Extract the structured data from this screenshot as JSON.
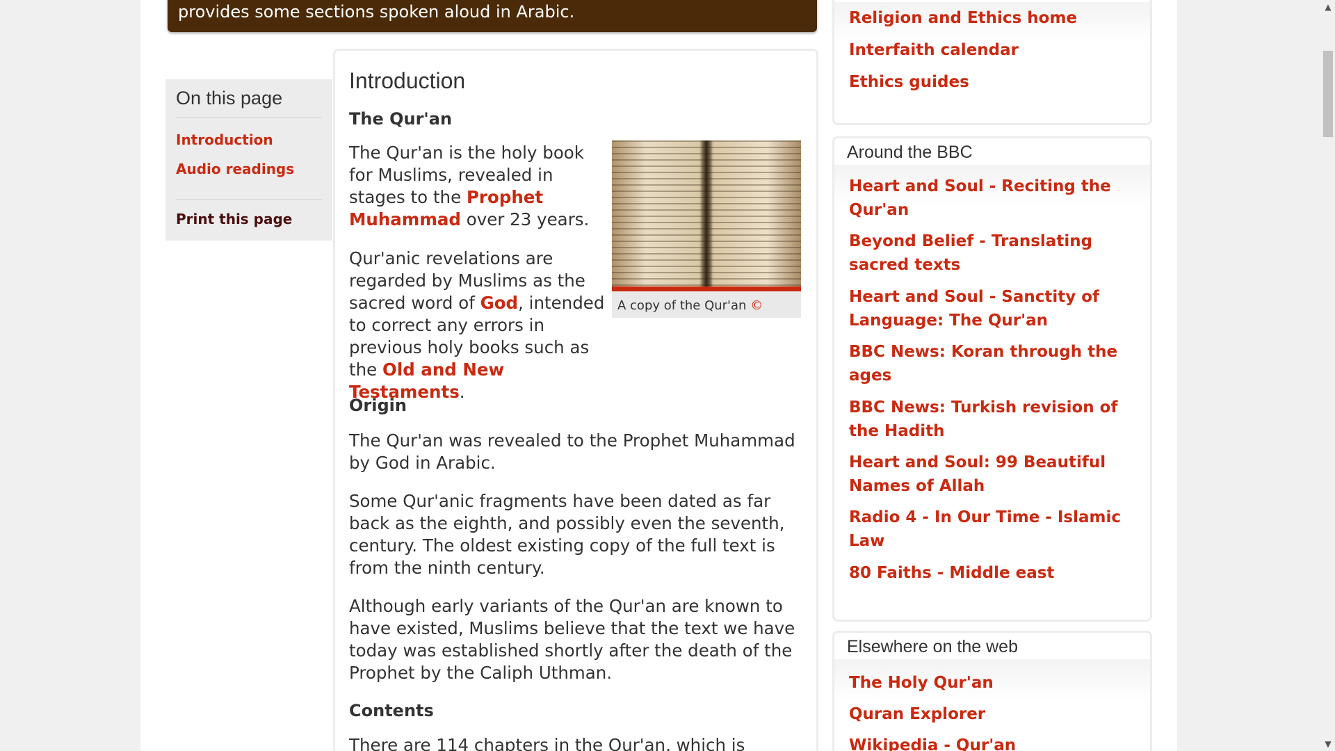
{
  "banner": {
    "text": "provides some sections spoken aloud in Arabic."
  },
  "side_nav": {
    "heading": "On this page",
    "items": [
      {
        "label": "Introduction"
      },
      {
        "label": "Audio readings"
      }
    ],
    "print_label": "Print this page"
  },
  "article": {
    "title": "Introduction",
    "sections": [
      {
        "heading": "The Qur'an"
      },
      {
        "heading": "Origin"
      },
      {
        "heading": "Contents"
      }
    ],
    "p1": {
      "t1": "The Qur'an is the holy book for Muslims, revealed in stages to the ",
      "link": "Prophet Muhammad",
      "t2": " over 23 years."
    },
    "p2": {
      "t1": "Qur'anic revelations are regarded by Muslims as the sacred word of ",
      "link1": "God",
      "t2": ", intended to correct any errors in previous holy books such as the ",
      "link2": "Old and New Testaments",
      "t3": "."
    },
    "p3": "The Qur'an was revealed to the Prophet Muhammad by God in Arabic.",
    "p4": "Some Qur'anic fragments have been dated as far back as the eighth, and possibly even the seventh, century. The oldest existing copy of the full text is from the ninth century.",
    "p5": "Although early variants of the Qur'an are known to have existed, Muslims believe that the text we have today was established shortly after the death of the Prophet by the Caliph Uthman.",
    "p6": "There are 114 chapters in the Qur'an, which is",
    "figure": {
      "caption": "A copy of the Qur'an",
      "copyright_symbol": "©"
    }
  },
  "right": {
    "top_links": [
      "Religion and Ethics home",
      "Interfaith calendar",
      "Ethics guides"
    ],
    "around": {
      "title": "Around the BBC",
      "links": [
        "Heart and Soul - Reciting the Qur'an",
        "Beyond Belief - Translating sacred texts",
        "Heart and Soul - Sanctity of Language: The Qur'an",
        "BBC News: Koran through the ages",
        "BBC News: Turkish revision of the Hadith",
        "Heart and Soul: 99 Beautiful Names of Allah",
        "Radio 4 - In Our Time - Islamic Law",
        "80 Faiths - Middle east"
      ]
    },
    "elsewhere": {
      "title": "Elsewhere on the web",
      "links": [
        "The Holy Qur'an",
        "Quran Explorer",
        "Wikipedia - Qur'an"
      ]
    }
  },
  "scrollbar": {
    "up_icon": "▲",
    "down_icon": "▼"
  }
}
